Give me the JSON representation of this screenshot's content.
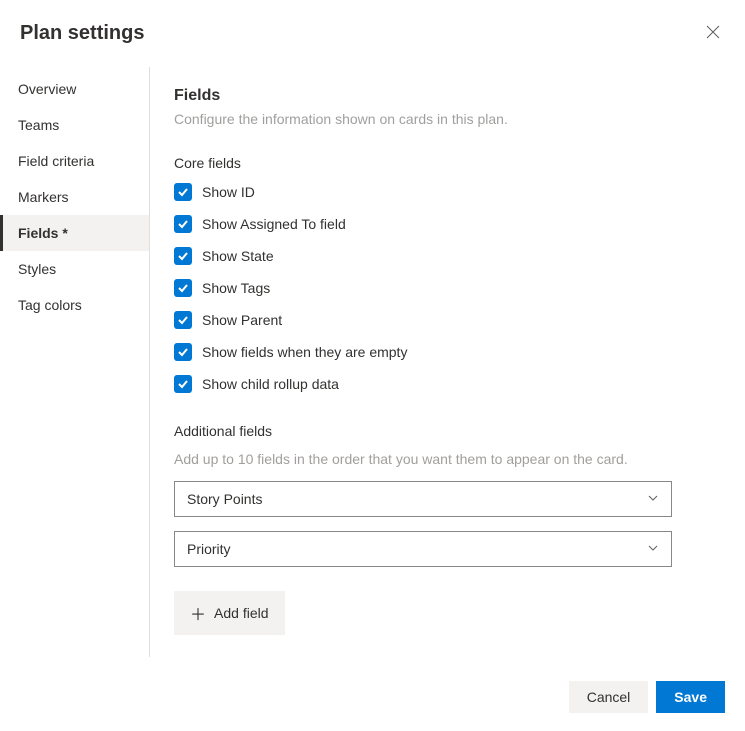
{
  "header": {
    "title": "Plan settings"
  },
  "sidebar": {
    "items": [
      {
        "label": "Overview",
        "active": false
      },
      {
        "label": "Teams",
        "active": false
      },
      {
        "label": "Field criteria",
        "active": false
      },
      {
        "label": "Markers",
        "active": false
      },
      {
        "label": "Fields *",
        "active": true
      },
      {
        "label": "Styles",
        "active": false
      },
      {
        "label": "Tag colors",
        "active": false
      }
    ]
  },
  "main": {
    "section_title": "Fields",
    "section_desc": "Configure the information shown on cards in this plan.",
    "core_fields": {
      "title": "Core fields",
      "items": [
        {
          "label": "Show ID",
          "checked": true
        },
        {
          "label": "Show Assigned To field",
          "checked": true
        },
        {
          "label": "Show State",
          "checked": true
        },
        {
          "label": "Show Tags",
          "checked": true
        },
        {
          "label": "Show Parent",
          "checked": true
        },
        {
          "label": "Show fields when they are empty",
          "checked": true
        },
        {
          "label": "Show child rollup data",
          "checked": true
        }
      ]
    },
    "additional_fields": {
      "title": "Additional fields",
      "desc": "Add up to 10 fields in the order that you want them to appear on the card.",
      "fields": [
        {
          "value": "Story Points"
        },
        {
          "value": "Priority"
        }
      ],
      "add_button": "Add field"
    }
  },
  "footer": {
    "cancel": "Cancel",
    "save": "Save"
  }
}
